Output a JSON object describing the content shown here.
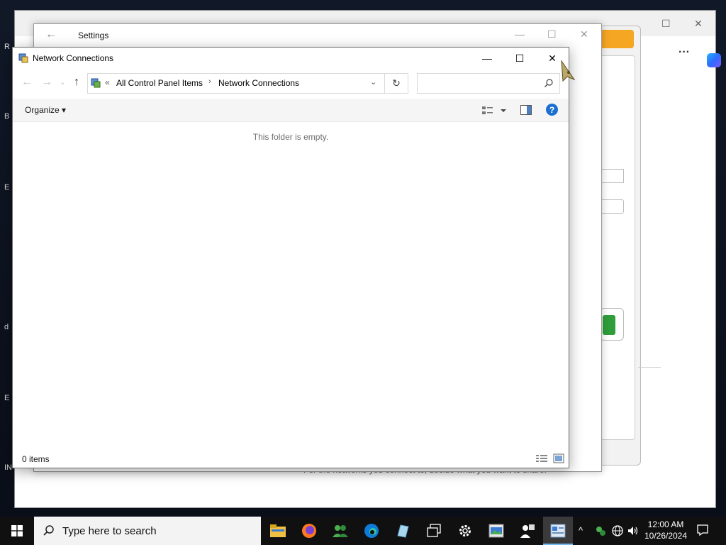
{
  "settings_window": {
    "title": "Settings"
  },
  "explorer": {
    "title": "Network Connections",
    "address": {
      "overflow": "«",
      "crumbs": [
        "All Control Panel Items",
        "Network Connections"
      ],
      "separator": "›"
    },
    "search": {
      "placeholder": ""
    },
    "command_bar": {
      "organize_label": "Organize ▾"
    },
    "content": {
      "empty_message": "This folder is empty."
    },
    "status": {
      "item_count": "0 items"
    }
  },
  "background_browser": {
    "partial_text": "For the networks you connect to, decide what you want to share."
  },
  "taskbar": {
    "search_placeholder": "Type here to search",
    "clock": {
      "time": "12:00 AM",
      "date": "10/26/2024"
    }
  },
  "colors": {
    "accent": "#1a6fd1",
    "taskbar": "#101010",
    "active_indicator": "#76b9ed"
  }
}
